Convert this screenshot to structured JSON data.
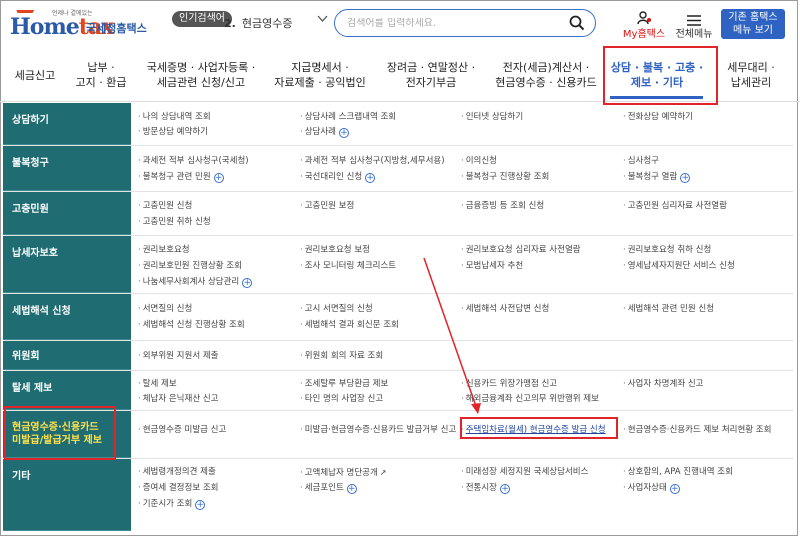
{
  "header": {
    "logo_tagline": "언제나 곁에있는",
    "logo_word_main": "Home",
    "logo_word_accent": "tax",
    "logo_name": "국세청홈택스",
    "popular_badge": "인기검색어",
    "popular_number": "2.",
    "popular_keyword": "현금영수증",
    "search_placeholder": "검색어를 입력하세요.",
    "my_hometax": "My홈택스",
    "all_menu": "전체메뉴",
    "classic_btn_line1": "기존 홈택스",
    "classic_btn_line2": "메뉴 보기"
  },
  "nav": {
    "items": [
      {
        "line1": "세금신고",
        "line2": ""
      },
      {
        "line1": "납부 ·",
        "line2": "고지 · 환급"
      },
      {
        "line1": "국세증명 · 사업자등록 ·",
        "line2": "세금관련 신청/신고"
      },
      {
        "line1": "지급명세서 ·",
        "line2": "자료제출 · 공익법인"
      },
      {
        "line1": "장려금 · 연말정산 ·",
        "line2": "전자기부금"
      },
      {
        "line1": "전자(세금)계산서 ·",
        "line2": "현금영수증 · 신용카드"
      },
      {
        "line1": "상담 · 불복 · 고충 ·",
        "line2": "제보 · 기타"
      },
      {
        "line1": "세무대리 ·",
        "line2": "납세관리"
      }
    ]
  },
  "rows": [
    {
      "title": "상담하기",
      "cells": [
        {
          "text": "나의 상담내역 조회",
          "plus": false
        },
        {
          "text": "방문상담 예약하기",
          "plus": false
        },
        {
          "text": "상담사례 스크랩내역 조회",
          "plus": false
        },
        {
          "text": "상담사례",
          "plus": true
        },
        {
          "text": "인터넷 상담하기",
          "plus": false
        },
        {
          "text": "전화상담 예약하기",
          "plus": false
        }
      ]
    },
    {
      "title": "불복청구",
      "cells": [
        {
          "text": "과세전 적부 심사청구(국세청)",
          "plus": false
        },
        {
          "text": "불복청구 관련 민원",
          "plus": true
        },
        {
          "text": "과세전 적부 심사청구(지방청,세무서용)",
          "plus": false
        },
        {
          "text": "국선대리인 신청",
          "plus": true
        },
        {
          "text": "이의신청",
          "plus": false
        },
        {
          "text": "불복청구 진행상황 조회",
          "plus": false
        },
        {
          "text": "심사청구",
          "plus": false
        },
        {
          "text": "불복청구 열람",
          "plus": true
        }
      ]
    },
    {
      "title": "고충민원",
      "cells": [
        {
          "text": "고충민원 신청",
          "plus": false
        },
        {
          "text": "고충민원 취하 신청",
          "plus": false
        },
        {
          "text": "고충민원 보정",
          "plus": false
        },
        {
          "text": "금융증빙 등 조회 신청",
          "plus": false
        },
        {
          "text": "고충민원 심리자료 사전열람",
          "plus": false
        }
      ]
    },
    {
      "title": "납세자보호",
      "cells": [
        {
          "text": "권리보호요청",
          "plus": false
        },
        {
          "text": "권리보호민원 진행상황 조회",
          "plus": false
        },
        {
          "text": "나눔세무사회계사 상담관리",
          "plus": true
        },
        {
          "text": "권리보호요청 보정",
          "plus": false
        },
        {
          "text": "조사 모니터링 체크리스트",
          "plus": false
        },
        {
          "text": "권리보호요청 심리자료 사전열람",
          "plus": false
        },
        {
          "text": "모범납세자 추천",
          "plus": false
        },
        {
          "text": "권리보호요청 취하 신청",
          "plus": false
        },
        {
          "text": "영세납세자지원단 서비스 신청",
          "plus": false
        }
      ]
    },
    {
      "title": "세법해석 신청",
      "cells": [
        {
          "text": "서면질의 신청",
          "plus": false
        },
        {
          "text": "세법해석 신청 진행상황 조회",
          "plus": false
        },
        {
          "text": "고시 서면질의 신청",
          "plus": false
        },
        {
          "text": "세법해석 결과 회신문 조회",
          "plus": false
        },
        {
          "text": "세법해석 사전답변 신청",
          "plus": false
        },
        {
          "text": "세법해석 관련 민원 신청",
          "plus": false
        }
      ]
    },
    {
      "title": "위원회",
      "cells": [
        {
          "text": "외부위원 지원서 제출",
          "plus": false
        },
        {
          "text": "위원회 회의 자료 조회",
          "plus": false
        }
      ]
    },
    {
      "title": "탈세 제보",
      "cells": [
        {
          "text": "탈세 제보",
          "plus": false
        },
        {
          "text": "체납자 은닉재산 신고",
          "plus": false
        },
        {
          "text": "조세탈루 부당환급 제보",
          "plus": false
        },
        {
          "text": "타인 명의 사업장 신고",
          "plus": false
        },
        {
          "text": "신용카드 위장가맹점 신고",
          "plus": false
        },
        {
          "text": "해외금융계좌 신고의무 위반행위 제보",
          "plus": false
        },
        {
          "text": "사업자 차명계좌 신고",
          "plus": false
        }
      ]
    },
    {
      "title_line1": "현금영수증·신용카드",
      "title_line2": "미발급/발급거부 제보",
      "cells": [
        {
          "text": "현금영수증 미발급 신고",
          "plus": false
        },
        {
          "text": "미발급·현금영수증·신용카드 발급거부 신고",
          "plus": false
        },
        {
          "text": "주택임차료(월세) 현금영수증 발급 신청",
          "plus": false
        },
        {
          "text": "현금영수증·신용카드 제보 처리현황 조회",
          "plus": false
        }
      ]
    },
    {
      "title": "기타",
      "cells": [
        {
          "text": "세법령개정의견 제출",
          "plus": false
        },
        {
          "text": "증여세 결정정보 조회",
          "plus": false
        },
        {
          "text": "기준시가 조회",
          "plus": true
        },
        {
          "text": "고액체납자 명단공개",
          "plus": false
        },
        {
          "text": "세금포인트",
          "plus": true
        },
        {
          "text": "미래성장 세정지원 국세상담서비스",
          "plus": false
        },
        {
          "text": "전통시장",
          "plus": true
        },
        {
          "text": "상호합의, APA 진행내역 조회",
          "plus": false
        },
        {
          "text": "사업자상태",
          "plus": true
        }
      ]
    }
  ],
  "colors": {
    "row_header_bg": "#1f6d73",
    "accent_blue": "#2f63c3",
    "highlight_red": "#e0242a"
  },
  "icons": {
    "search": "search-icon",
    "my_hometax": "user-icon",
    "all_menu": "hamburger-icon",
    "expand": "plus-circle-icon",
    "external": "external-link-icon"
  }
}
